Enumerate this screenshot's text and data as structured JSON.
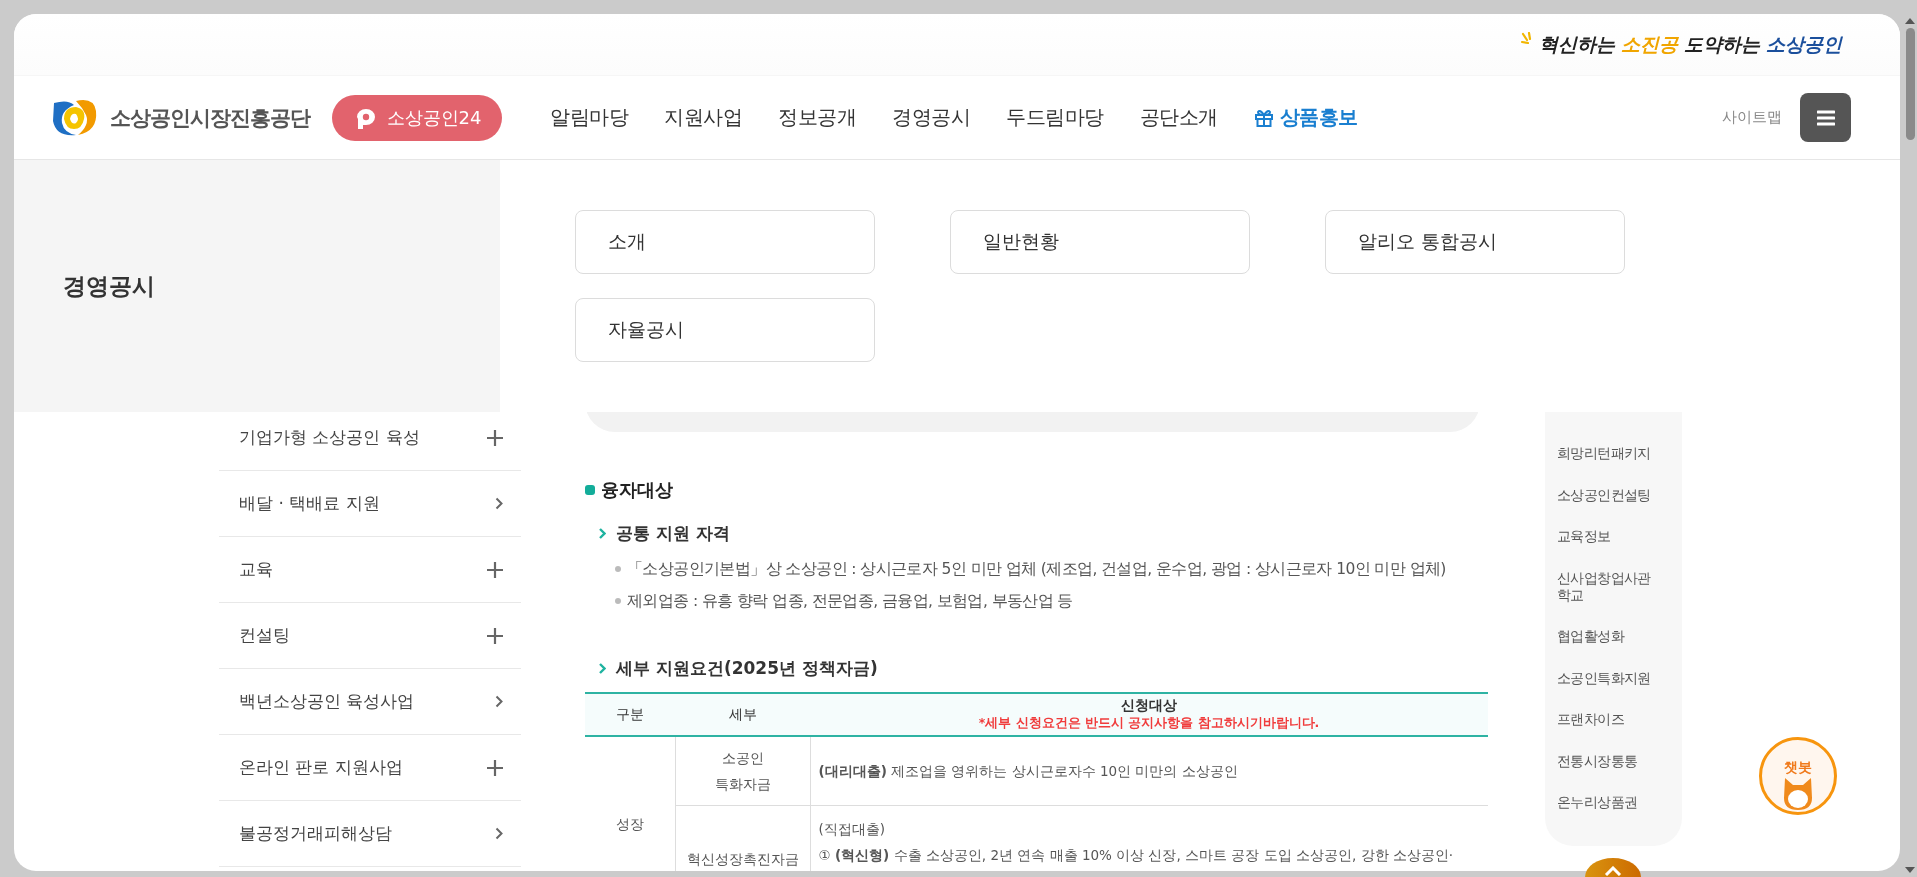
{
  "slogan": {
    "parts": [
      {
        "text": "혁신하는",
        "color": "#222222"
      },
      {
        "text": "소진공",
        "color": "#f0a500"
      },
      {
        "text": "도약하는",
        "color": "#222222"
      },
      {
        "text": "소상공인",
        "color": "#1b4f9c"
      }
    ]
  },
  "header": {
    "logo_text": "소상공인시장진흥공단",
    "portal_button": "소상공인24",
    "sitemap": "사이트맵",
    "nav": [
      {
        "label": "알림마당",
        "kind": "plain"
      },
      {
        "label": "지원사업",
        "kind": "plain"
      },
      {
        "label": "정보공개",
        "kind": "plain"
      },
      {
        "label": "경영공시",
        "kind": "plain"
      },
      {
        "label": "두드림마당",
        "kind": "plain"
      },
      {
        "label": "공단소개",
        "kind": "plain"
      },
      {
        "label": "상품홍보",
        "kind": "promo"
      }
    ]
  },
  "mega_menu": {
    "title": "경영공시",
    "items": [
      "소개",
      "일반현황",
      "알리오 통합공시",
      "자율공시"
    ]
  },
  "sidebar": {
    "items": [
      {
        "label": "기업가형 소상공인 육성",
        "kind": "expand"
      },
      {
        "label": "배달 · 택배료 지원",
        "kind": "link"
      },
      {
        "label": "교육",
        "kind": "expand"
      },
      {
        "label": "컨설팅",
        "kind": "expand"
      },
      {
        "label": "백년소상공인 육성사업",
        "kind": "link"
      },
      {
        "label": "온라인 판로 지원사업",
        "kind": "expand"
      },
      {
        "label": "불공정거래피해상담",
        "kind": "link"
      }
    ]
  },
  "content": {
    "section_title": "융자대상",
    "eligibility": {
      "title": "공통 지원 자격",
      "bullets": [
        "「소상공인기본법」상 소상공인 : 상시근로자 5인 미만 업체 (제조업, 건설업, 운수업, 광업 : 상시근로자 10인 미만 업체)",
        "제외업종 : 유흥 향락 업종, 전문업종, 금융업, 보험업, 부동산업 등"
      ]
    },
    "requirements": {
      "title": "세부 지원요건(2025년 정책자금)",
      "table": {
        "columns": [
          "구분",
          "세부",
          "신청대상"
        ],
        "note": "*세부 신청요건은 반드시 공지사항을 참고하시기바랍니다.",
        "groups": [
          {
            "category": "성장",
            "rows": [
              {
                "detail": [
                  "소공인",
                  "특화자금"
                ],
                "lines": [
                  "**(대리대출)** 제조업을 영위하는 상시근로자수 10인 미만의 소상공인"
                ]
              },
              {
                "detail": [
                  "혁신성장촉진자금"
                ],
                "lines": [
                  "(직접대출)",
                  "① **(혁신형)** 수출 소상공인, 2년 연속 매출 10% 이상 신장, 스마트 공장 도입 소상공인, 강한 소상공인·"
                ]
              }
            ]
          }
        ]
      }
    }
  },
  "right_menu": {
    "items": [
      "희망리턴패키지",
      "소상공인컨설팅",
      "교육정보",
      "신사업창업사관학교",
      "협업활성화",
      "소공인특화지원",
      "프랜차이즈",
      "전통시장통통",
      "온누리상품권"
    ]
  },
  "chatbot": {
    "label": "챗봇"
  }
}
